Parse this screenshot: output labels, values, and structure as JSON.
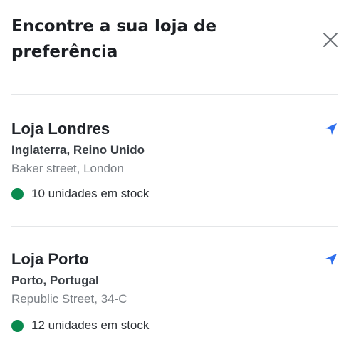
{
  "header": {
    "title": "Encontre a sua loja de preferência",
    "close_icon": "close-icon"
  },
  "colors": {
    "accent": "#2f6fed",
    "in_stock": "#0a8a4f",
    "divider": "#e4e6e8"
  },
  "stores": [
    {
      "name": "Loja Londres",
      "region": "Inglaterra, Reino Unido",
      "address": "Baker street, London",
      "stock": "10 unidades em stock",
      "nav_icon": "navigation-arrow-icon"
    },
    {
      "name": "Loja Porto",
      "region": "Porto, Portugal",
      "address": "Republic Street, 34-C",
      "stock": "12 unidades em stock",
      "nav_icon": "navigation-arrow-icon"
    }
  ]
}
